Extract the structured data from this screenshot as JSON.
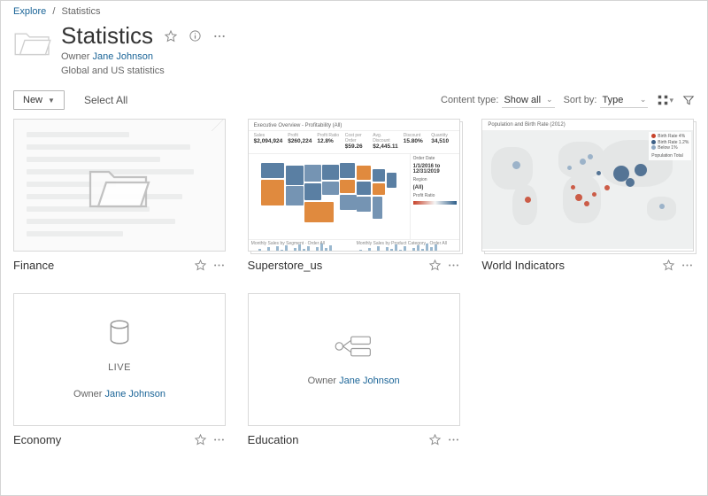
{
  "breadcrumb": {
    "root": "Explore",
    "current": "Statistics"
  },
  "page": {
    "title": "Statistics",
    "owner_label": "Owner",
    "owner_name": "Jane Johnson",
    "description": "Global and US statistics"
  },
  "toolbar": {
    "new_label": "New",
    "select_all": "Select All",
    "content_type_label": "Content type:",
    "content_type_value": "Show all",
    "sort_label": "Sort by:",
    "sort_value": "Type"
  },
  "cards": {
    "finance": {
      "title": "Finance"
    },
    "superstore": {
      "title": "Superstore_us",
      "viz_title": "Executive Overview - Profitability (All)",
      "kpis": [
        {
          "lab": "Sales",
          "val": "$2,094,924"
        },
        {
          "lab": "Profit",
          "val": "$260,224"
        },
        {
          "lab": "Profit Ratio",
          "val": "12.8%"
        },
        {
          "lab": "Cost per Order",
          "val": "$59.26"
        },
        {
          "lab": "Avg. Discount",
          "val": "$2,445.11"
        },
        {
          "lab": "Discount",
          "val": "15.80%"
        },
        {
          "lab": "Quantity",
          "val": "34,510"
        }
      ],
      "side": {
        "order_date_label": "Order Date",
        "order_date_value": "1/1/2016 to 12/31/2019",
        "region_label": "Region",
        "region_value": "(All)",
        "ratio_label": "Profit Ratio"
      },
      "spark_left": "Monthly Sales by Segment · Order  All",
      "spark_right": "Monthly Sales by Product Category · Order  All"
    },
    "world": {
      "title": "World Indicators",
      "viz_title": "Population and Birth Rate (2012)",
      "legend": {
        "a": "Birth Rate 4%",
        "b": "Birth Rate 1.2%",
        "c": "Below 1%",
        "d": "Population Total"
      }
    },
    "economy": {
      "title": "Economy",
      "live": "LIVE",
      "owner_label": "Owner",
      "owner_name": "Jane Johnson"
    },
    "education": {
      "title": "Education",
      "owner_label": "Owner",
      "owner_name": "Jane Johnson"
    }
  }
}
